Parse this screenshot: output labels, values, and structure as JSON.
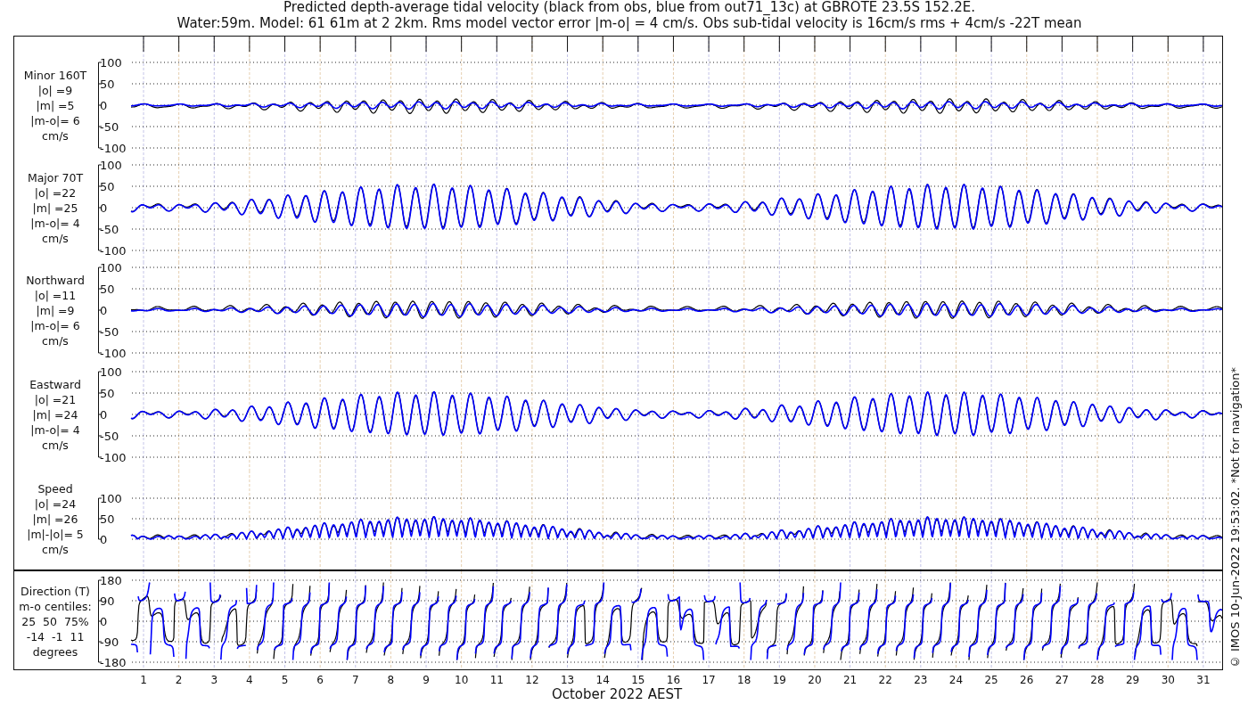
{
  "title_lines": [
    "Predicted depth-average tidal velocity (black from obs, blue from out71_13c) at GBROTE 23.5S 152.2E.",
    "Water:59m. Model: 61 61m at 2 2km. Rms model vector error |m-o| = 4 cm/s. Obs sub-tidal velocity is 16cm/s rms + 4cm/s -22T mean"
  ],
  "traces": [
    {
      "kind": "observed",
      "color": "#000000"
    },
    {
      "kind": "model",
      "color": "#0000ff"
    }
  ],
  "panels": [
    {
      "kind": "minor",
      "label_lines": [
        "Minor 160T",
        "|o| =9",
        "|m| =5",
        "|m-o|= 6",
        "cm/s"
      ],
      "yticks": [
        "100",
        "50",
        "0",
        "-50",
        "-100"
      ]
    },
    {
      "kind": "major",
      "label_lines": [
        "Major 70T",
        "|o| =22",
        "|m| =25",
        "|m-o|= 4",
        "cm/s"
      ],
      "yticks": [
        "100",
        "50",
        "0",
        "-50",
        "-100"
      ]
    },
    {
      "kind": "north",
      "label_lines": [
        "Northward",
        "|o| =11",
        "|m| =9",
        "|m-o|= 6",
        "cm/s"
      ],
      "yticks": [
        "100",
        "50",
        "0",
        "-50",
        "-100"
      ]
    },
    {
      "kind": "east",
      "label_lines": [
        "Eastward",
        "|o| =21",
        "|m| =24",
        "|m-o|= 4",
        "cm/s"
      ],
      "yticks": [
        "100",
        "50",
        "0",
        "-50",
        "-100"
      ]
    },
    {
      "kind": "speed",
      "label_lines": [
        "Speed",
        "|o| =24",
        "|m| =26",
        "|m|-|o|= 5",
        "cm/s"
      ],
      "yticks": [
        "100",
        "50",
        "0"
      ]
    },
    {
      "kind": "direction",
      "label_lines": [
        "Direction (T)",
        "m-o centiles:",
        "25  50  75%",
        "-14  -1  11",
        "degrees"
      ],
      "yticks": [
        "180",
        "90",
        "0",
        "-90",
        "-180"
      ]
    }
  ],
  "x_axis": {
    "ticks": [
      "1",
      "2",
      "3",
      "4",
      "5",
      "6",
      "7",
      "8",
      "9",
      "10",
      "11",
      "12",
      "13",
      "14",
      "15",
      "16",
      "17",
      "18",
      "19",
      "20",
      "21",
      "22",
      "23",
      "24",
      "25",
      "26",
      "27",
      "28",
      "29",
      "30",
      "31"
    ],
    "label": "October 2022 AEST"
  },
  "side_note": "© IMOS 10-Jun-2022 19:53:02. *Not for navigation*"
}
